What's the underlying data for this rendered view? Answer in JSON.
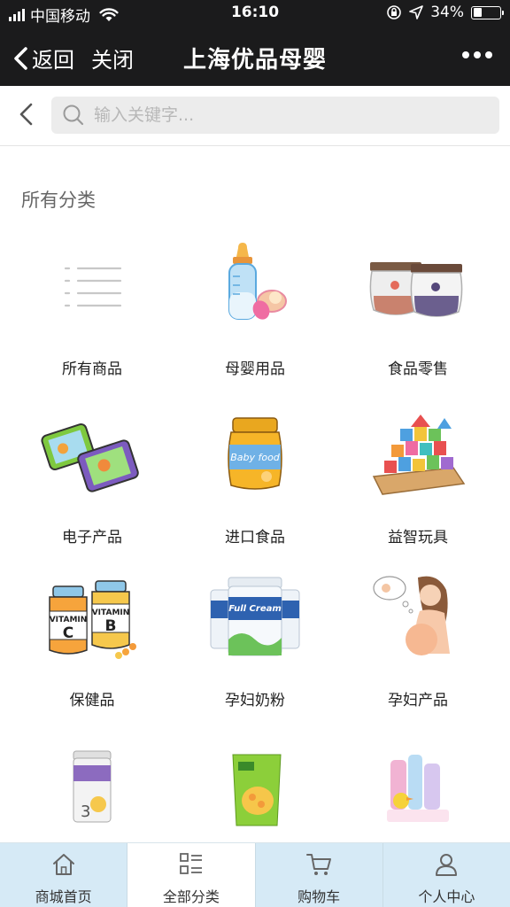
{
  "status_bar": {
    "carrier": "中国移动",
    "time": "16:10",
    "battery_percent": "34%",
    "battery_level": 0.34,
    "icons": [
      "signal-icon",
      "wifi-icon",
      "rotation-lock-icon",
      "location-icon",
      "battery-icon"
    ]
  },
  "nav": {
    "back_label": "返回",
    "close_label": "关闭",
    "title": "上海优品母婴",
    "more_icon": "more-dots-icon"
  },
  "search": {
    "placeholder": "输入关键字..."
  },
  "section": {
    "title": "所有分类"
  },
  "categories": [
    {
      "label": "所有商品",
      "icon": "list-icon"
    },
    {
      "label": "母婴用品",
      "icon": "baby-bottle-icon"
    },
    {
      "label": "食品零售",
      "icon": "jam-jar-icon"
    },
    {
      "label": "电子产品",
      "icon": "tablet-icon"
    },
    {
      "label": "进口食品",
      "icon": "baby-food-jar-icon"
    },
    {
      "label": "益智玩具",
      "icon": "building-blocks-icon"
    },
    {
      "label": "保健品",
      "icon": "vitamin-bottle-icon"
    },
    {
      "label": "孕妇奶粉",
      "icon": "milk-powder-can-icon"
    },
    {
      "label": "孕妇产品",
      "icon": "pregnant-woman-icon"
    },
    {
      "label": "",
      "icon": "formula-can-icon"
    },
    {
      "label": "",
      "icon": "cereal-box-icon"
    },
    {
      "label": "",
      "icon": "baby-toiletries-icon"
    }
  ],
  "tabs": [
    {
      "label": "商城首页",
      "icon": "home-icon",
      "active": false
    },
    {
      "label": "全部分类",
      "icon": "category-icon",
      "active": true
    },
    {
      "label": "购物车",
      "icon": "cart-icon",
      "active": false
    },
    {
      "label": "个人中心",
      "icon": "user-icon",
      "active": false
    }
  ],
  "colors": {
    "header_bg": "#1b1b1c",
    "tab_bg": "#d6eaf6",
    "tab_active_bg": "#ffffff"
  }
}
